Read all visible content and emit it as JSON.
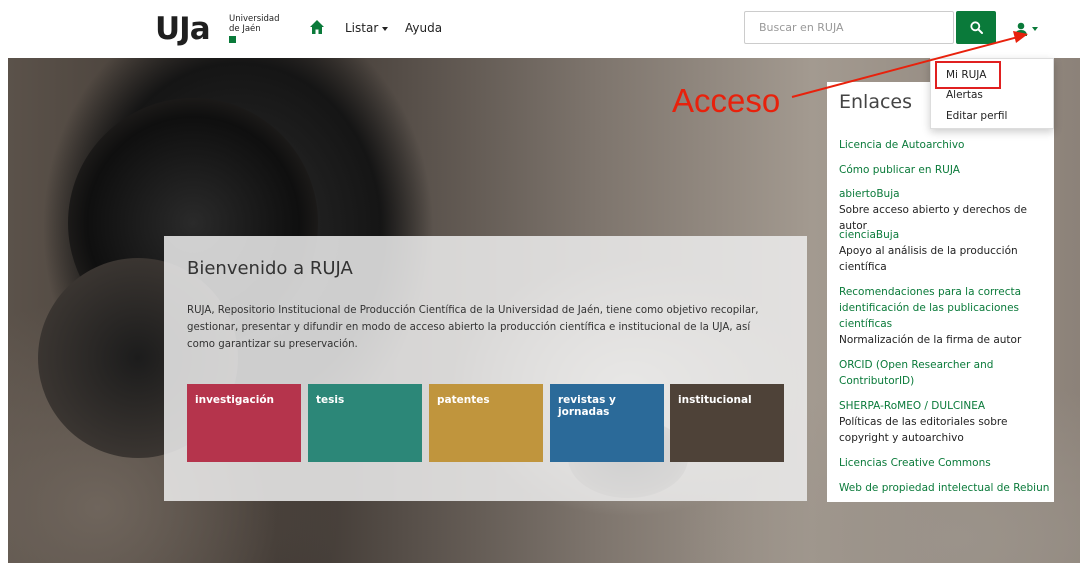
{
  "header": {
    "logo_mark": "UJa",
    "logo_text_line1": "Universidad",
    "logo_text_line2": "de Jaén",
    "nav": {
      "list_label": "Listar",
      "help_label": "Ayuda"
    },
    "search": {
      "placeholder": "Buscar en RUJA",
      "value": ""
    }
  },
  "user_menu": {
    "items": [
      "Mi RUJA",
      "Alertas",
      "Editar perfil"
    ]
  },
  "welcome": {
    "title": "Bienvenido a RUJA",
    "text": "RUJA, Repositorio Institucional de Producción Científica de la Universidad de Jaén, tiene como objetivo recopilar, gestionar, presentar y difundir en modo de acceso abierto la producción científica e institucional de la UJA, así como garantizar su preservación.",
    "tiles": [
      {
        "label": "investigación",
        "color": "#b5344c"
      },
      {
        "label": "tesis",
        "color": "#2c8778"
      },
      {
        "label": "patentes",
        "color": "#c0953d"
      },
      {
        "label": "revistas y jornadas",
        "color": "#2b6a99"
      },
      {
        "label": "institucional",
        "color": "#4e4238"
      }
    ]
  },
  "sidebar": {
    "title": "Enlaces",
    "links": [
      {
        "label": "Licencia de Autoarchivo"
      },
      {
        "label": "Cómo publicar en RUJA"
      },
      {
        "label": "abiertoBuja",
        "desc": "Sobre acceso abierto y derechos de autor"
      },
      {
        "label": "cienciaBuja",
        "desc": "Apoyo al análisis de la producción científica"
      },
      {
        "label": "Recomendaciones para la correcta identificación de las publicaciones científicas",
        "desc": "Normalización de la firma de autor"
      },
      {
        "label": "ORCID (Open Researcher and ContributorID)"
      },
      {
        "label": "SHERPA-RoMEO / DULCINEA",
        "desc": "Políticas de las editoriales sobre copyright y autoarchivo"
      },
      {
        "label": "Licencias Creative Commons"
      },
      {
        "label": "Web de propiedad intelectual de Rebiun"
      }
    ]
  },
  "annotation": {
    "label": "Acceso",
    "color": "#e8210c"
  },
  "colors": {
    "brand_green": "#0a7a3a",
    "link_green": "#0a7a3a"
  },
  "icons": {
    "home": "home-icon",
    "search": "search-icon",
    "user": "user-icon"
  }
}
